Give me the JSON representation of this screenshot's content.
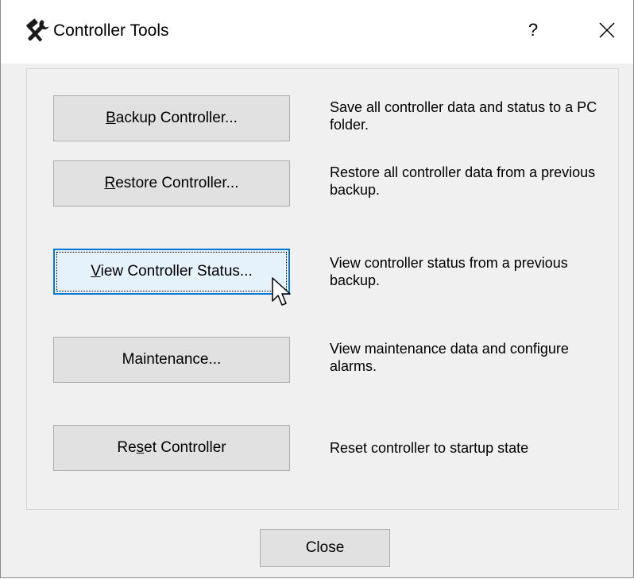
{
  "window": {
    "title": "Controller Tools",
    "help_label": "?",
    "close_icon": "close-icon",
    "title_icon": "tools-icon"
  },
  "actions": [
    {
      "label_pre": "",
      "label_accel": "B",
      "label_post": "ackup Controller...",
      "description": "Save all controller data and status to a PC folder."
    },
    {
      "label_pre": "",
      "label_accel": "R",
      "label_post": "estore Controller...",
      "description": "Restore all controller data from a previous backup."
    },
    {
      "label_pre": "",
      "label_accel": "V",
      "label_post": "iew Controller Status...",
      "description": "View controller status from a previous backup."
    },
    {
      "label_pre": "Maintenance...",
      "label_accel": "",
      "label_post": "",
      "description": "View maintenance data and configure alarms."
    },
    {
      "label_pre": "Re",
      "label_accel": "s",
      "label_post": "et Controller",
      "description": "Reset controller to startup state"
    }
  ],
  "footer": {
    "close_label": "Close"
  },
  "colors": {
    "focus_border": "#0078d7",
    "button_face": "#e1e1e1",
    "dialog_bg": "#f0f0f0"
  }
}
